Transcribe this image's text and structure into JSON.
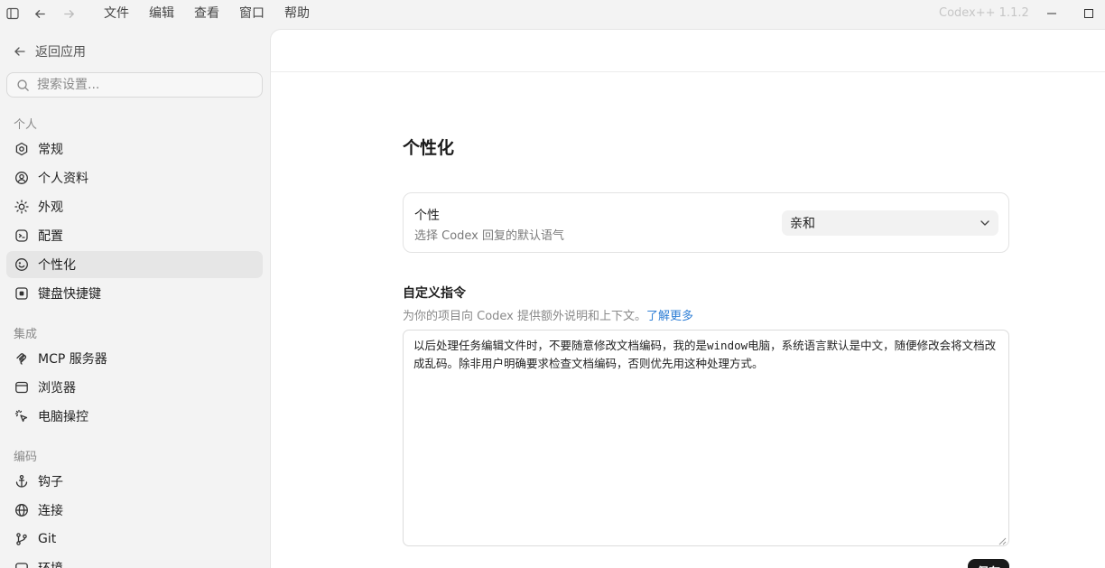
{
  "titlebar": {
    "menu": [
      "文件",
      "编辑",
      "查看",
      "窗口",
      "帮助"
    ],
    "app_version": "Codex++ 1.1.2"
  },
  "sidebar": {
    "back_label": "返回应用",
    "search_placeholder": "搜索设置...",
    "sections": [
      {
        "label": "个人",
        "items": [
          {
            "label": "常规",
            "icon": "settings-hex-icon"
          },
          {
            "label": "个人资料",
            "icon": "user-circle-icon"
          },
          {
            "label": "外观",
            "icon": "sun-icon"
          },
          {
            "label": "配置",
            "icon": "config-icon"
          },
          {
            "label": "个性化",
            "icon": "smile-icon",
            "active": true
          },
          {
            "label": "键盘快捷键",
            "icon": "keyboard-icon"
          }
        ]
      },
      {
        "label": "集成",
        "items": [
          {
            "label": "MCP 服务器",
            "icon": "mcp-icon"
          },
          {
            "label": "浏览器",
            "icon": "browser-icon"
          },
          {
            "label": "电脑操控",
            "icon": "cursor-click-icon"
          }
        ]
      },
      {
        "label": "编码",
        "items": [
          {
            "label": "钩子",
            "icon": "anchor-icon"
          },
          {
            "label": "连接",
            "icon": "globe-icon"
          },
          {
            "label": "Git",
            "icon": "git-branch-icon"
          },
          {
            "label": "环境",
            "icon": "environment-icon"
          }
        ]
      }
    ]
  },
  "main": {
    "title": "个性化",
    "personality": {
      "title": "个性",
      "description": "选择 Codex 回复的默认语气",
      "selected": "亲和"
    },
    "custom_instructions": {
      "title": "自定义指令",
      "description": "为你的项目向 Codex 提供额外说明和上下文。",
      "link": "了解更多",
      "value": "以后处理任务编辑文件时，不要随意修改文档编码，我的是window电脑，系统语言默认是中文，随便修改会将文档改成乱码。除非用户明确要求检查文档编码，否则优先用这种处理方式。"
    },
    "save_label": "保存"
  }
}
